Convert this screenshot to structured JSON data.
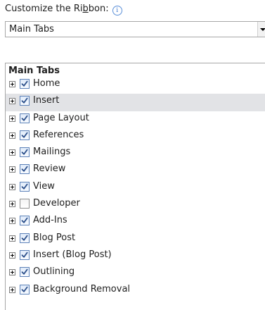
{
  "customize": {
    "label_before": "Customize the Ri",
    "label_underlined": "b",
    "label_after": "bon:",
    "info_icon": "info-icon"
  },
  "dropdown": {
    "selected_value": "Main Tabs"
  },
  "tree": {
    "header": "Main Tabs",
    "items": [
      {
        "label": "Home",
        "checked": true,
        "selected": false
      },
      {
        "label": "Insert",
        "checked": true,
        "selected": true
      },
      {
        "label": "Page Layout",
        "checked": true,
        "selected": false
      },
      {
        "label": "References",
        "checked": true,
        "selected": false
      },
      {
        "label": "Mailings",
        "checked": true,
        "selected": false
      },
      {
        "label": "Review",
        "checked": true,
        "selected": false
      },
      {
        "label": "View",
        "checked": true,
        "selected": false
      },
      {
        "label": "Developer",
        "checked": false,
        "selected": false
      },
      {
        "label": "Add-Ins",
        "checked": true,
        "selected": false
      },
      {
        "label": "Blog Post",
        "checked": true,
        "selected": false
      },
      {
        "label": "Insert (Blog Post)",
        "checked": true,
        "selected": false
      },
      {
        "label": "Outlining",
        "checked": true,
        "selected": false
      },
      {
        "label": "Background Removal",
        "checked": true,
        "selected": false
      }
    ]
  },
  "colors": {
    "selected_row": "#e2e3e6",
    "checkmark": "#2b4f8a",
    "border": "#a7a7a7"
  }
}
